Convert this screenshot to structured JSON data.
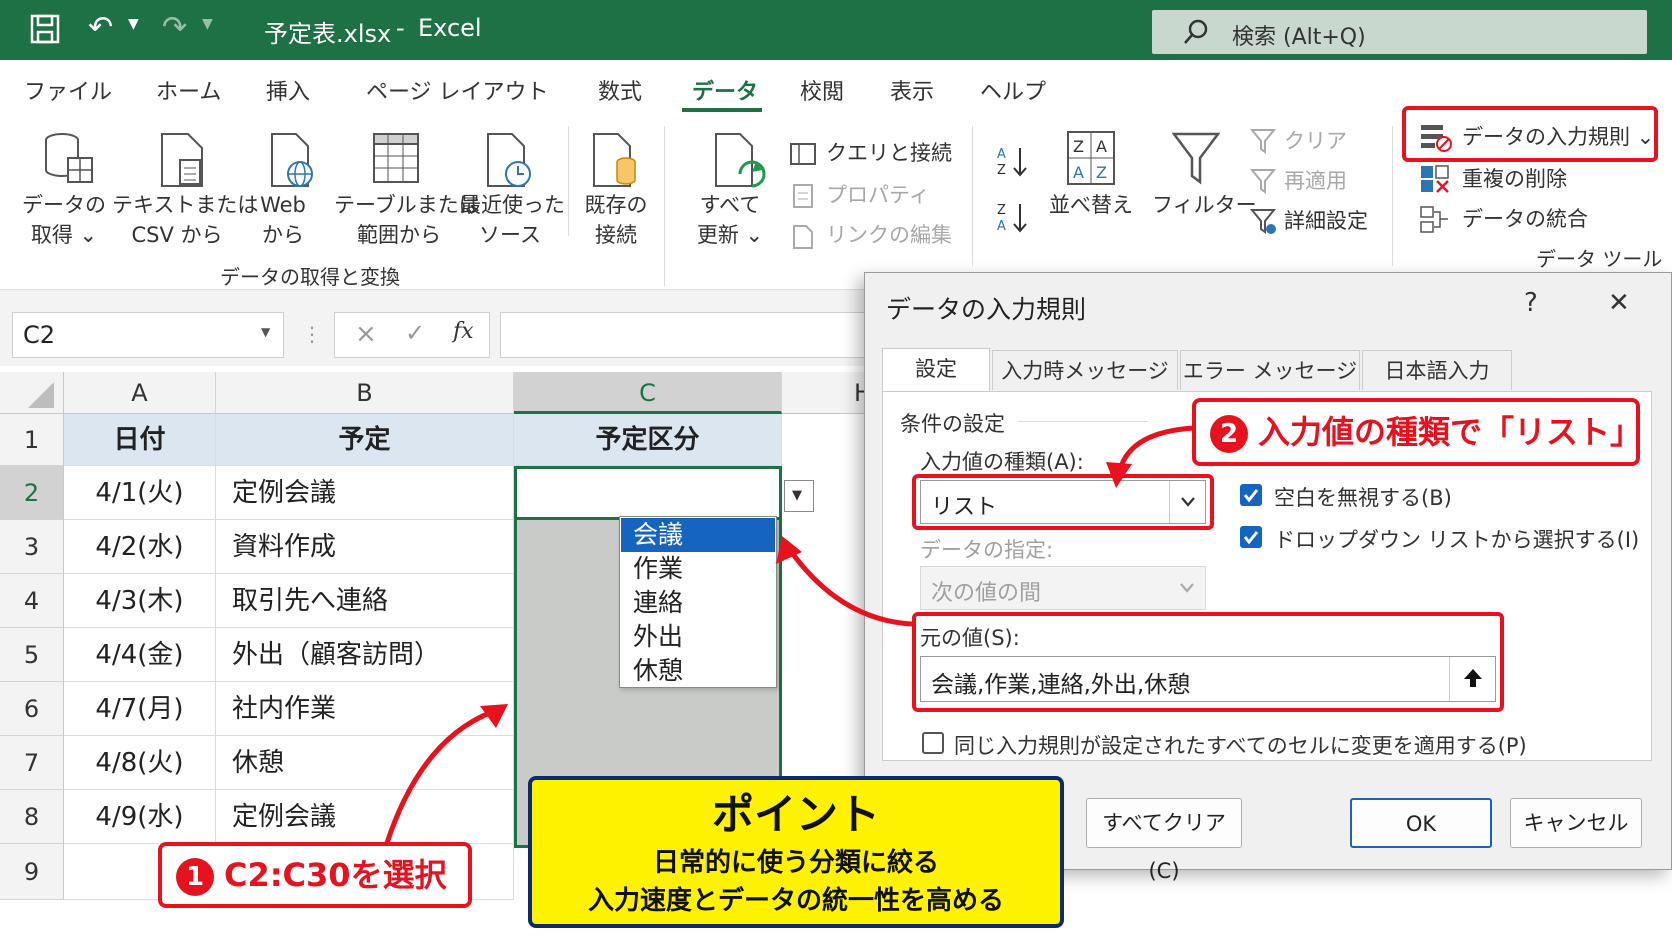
{
  "title_bar": {
    "filename": "予定表.xlsx",
    "separator": "-",
    "app": "Excel",
    "search_placeholder": "検索 (Alt+Q)"
  },
  "menu": [
    "ファイル",
    "ホーム",
    "挿入",
    "ページ レイアウト",
    "数式",
    "データ",
    "校閲",
    "表示",
    "ヘルプ"
  ],
  "active_menu": "データ",
  "ribbon": {
    "get_data": "データの\n取得 ⌄",
    "text_csv": "テキストまたは\nCSV から",
    "web": "Web\nから",
    "table_range": "テーブルまたは\n範囲から",
    "recent": "最近使った\nソース",
    "existing": "既存の\n接続",
    "group1": "データの取得と変換",
    "refresh_all": "すべて\n更新 ⌄",
    "queries": "クエリと接続",
    "properties": "プロパティ",
    "edit_links": "リンクの編集",
    "sort": "並べ替え",
    "filter": "フィルター",
    "clear": "クリア",
    "reapply": "再適用",
    "advanced": "詳細設定",
    "validation": "データの入力規則 ⌄",
    "remove_dup": "重複の削除",
    "consolidate": "データの統合",
    "group_tools": "データ ツール"
  },
  "formula_bar": {
    "name_box": "C2",
    "cancel": "×",
    "enter": "✓",
    "fx": "fx"
  },
  "sheet": {
    "columns": [
      "A",
      "B",
      "C",
      "H"
    ],
    "rows": [
      "1",
      "2",
      "3",
      "4",
      "5",
      "6",
      "7",
      "8",
      "9"
    ],
    "headers": [
      "日付",
      "予定",
      "予定区分"
    ],
    "data": [
      [
        "4/1(火)",
        "定例会議"
      ],
      [
        "4/2(水)",
        "資料作成"
      ],
      [
        "4/3(木)",
        "取引先へ連絡"
      ],
      [
        "4/4(金)",
        "外出（顧客訪問）"
      ],
      [
        "4/7(月)",
        "社内作業"
      ],
      [
        "4/8(火)",
        "休憩"
      ],
      [
        "4/9(水)",
        "定例会議"
      ]
    ],
    "dropdown_items": [
      "会議",
      "作業",
      "連絡",
      "外出",
      "休憩"
    ],
    "dropdown_selected": "会議"
  },
  "dialog": {
    "title": "データの入力規則",
    "help": "?",
    "close": "✕",
    "tabs": [
      "設定",
      "入力時メッセージ",
      "エラー メッセージ",
      "日本語入力"
    ],
    "section": "条件の設定",
    "allow_label": "入力値の種類(A):",
    "allow_value": "リスト",
    "ignore_blank": "空白を無視する(B)",
    "dropdown_list": "ドロップダウン リストから選択する(I)",
    "data_label": "データの指定:",
    "data_value": "次の値の間",
    "source_label": "元の値(S):",
    "source_value": "会議,作業,連絡,外出,休憩",
    "apply_all": "同じ入力規則が設定されたすべてのセルに変更を適用する(P)",
    "clear_all": "すべてクリア(C)",
    "ok": "OK",
    "cancel": "キャンセル"
  },
  "annotations": {
    "step1": "C2:C30を選択",
    "step1_num": "1",
    "step2": "入力値の種類で「リスト」",
    "step2_num": "2",
    "point_title": "ポイント",
    "point_line1": "日常的に使う分類に絞る",
    "point_line2": "入力速度とデータの統一性を高める"
  },
  "colors": {
    "excel_green": "#1e7145",
    "highlight_red": "#e8121e",
    "point_yellow": "#fff200",
    "header_blue": "#dce6f1"
  }
}
